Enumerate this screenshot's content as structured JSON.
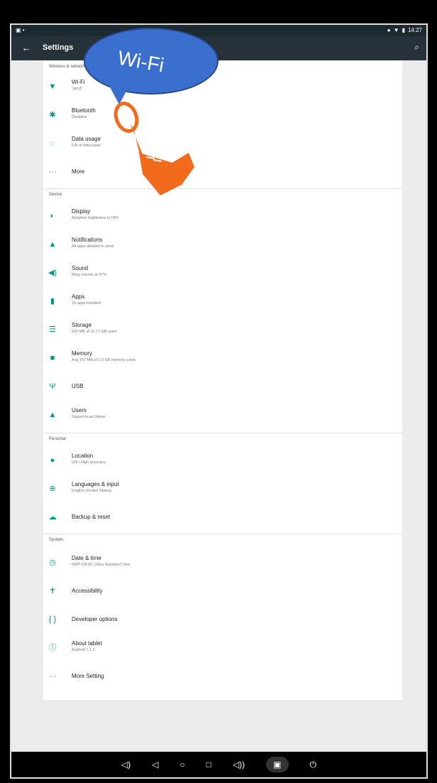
{
  "statusbar": {
    "time": "14:27"
  },
  "toolbar": {
    "title": "Settings"
  },
  "overlay": {
    "label": "Wi-Fi"
  },
  "sections": [
    {
      "header": "Wireless & networks",
      "items": [
        {
          "title": "Wi-Fi",
          "subtitle": "\"pinzi\"",
          "icon": "wifi-icon"
        },
        {
          "title": "Bluetooth",
          "subtitle": "Disabled",
          "icon": "bluetooth-icon"
        },
        {
          "title": "Data usage",
          "subtitle": "0 B of data used",
          "icon": "data-usage-icon"
        },
        {
          "title": "More",
          "subtitle": "",
          "icon": "more-icon"
        }
      ]
    },
    {
      "header": "Device",
      "items": [
        {
          "title": "Display",
          "subtitle": "Adaptive brightness is OFF",
          "icon": "display-icon"
        },
        {
          "title": "Notifications",
          "subtitle": "All apps allowed to send",
          "icon": "notifications-icon"
        },
        {
          "title": "Sound",
          "subtitle": "Ring volume at 57%",
          "icon": "sound-icon"
        },
        {
          "title": "Apps",
          "subtitle": "19 apps installed",
          "icon": "apps-icon"
        },
        {
          "title": "Storage",
          "subtitle": "602 MB of 11.77 GB used",
          "icon": "storage-icon"
        },
        {
          "title": "Memory",
          "subtitle": "Avg 757 MB of 2.0 GB memory used",
          "icon": "memory-icon"
        },
        {
          "title": "USB",
          "subtitle": "",
          "icon": "usb-icon"
        },
        {
          "title": "Users",
          "subtitle": "Signed in as Owner",
          "icon": "users-icon"
        }
      ]
    },
    {
      "header": "Personal",
      "items": [
        {
          "title": "Location",
          "subtitle": "ON / High accuracy",
          "icon": "location-icon"
        },
        {
          "title": "Languages & input",
          "subtitle": "English (United States)",
          "icon": "language-icon"
        },
        {
          "title": "Backup & reset",
          "subtitle": "",
          "icon": "backup-icon"
        }
      ]
    },
    {
      "header": "System",
      "items": [
        {
          "title": "Date & time",
          "subtitle": "GMT+08:00 China Standard Time",
          "icon": "clock-icon"
        },
        {
          "title": "Accessibility",
          "subtitle": "",
          "icon": "accessibility-icon"
        },
        {
          "title": "Developer options",
          "subtitle": "",
          "icon": "developer-icon"
        },
        {
          "title": "About tablet",
          "subtitle": "Android 7.1.2",
          "icon": "info-icon"
        },
        {
          "title": "More Setting",
          "subtitle": "",
          "icon": "more-icon"
        }
      ]
    }
  ],
  "colors": {
    "accent": "#009688",
    "toolbar": "#263238",
    "bubble": "#3a6fd0",
    "hand": "#f26b1d"
  }
}
